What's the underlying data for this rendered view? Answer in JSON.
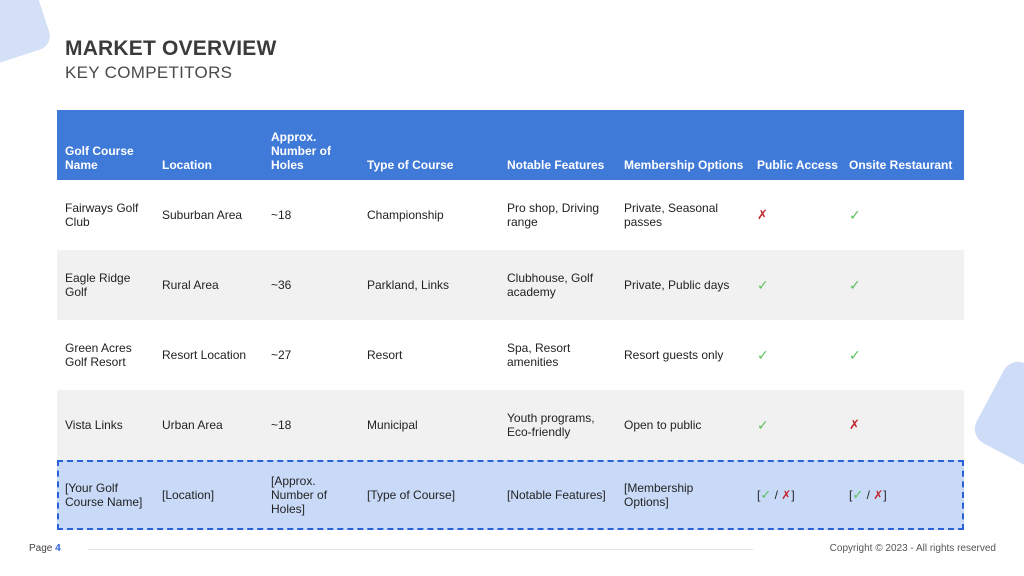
{
  "slide": {
    "title": "MARKET OVERVIEW",
    "subtitle": "KEY COMPETITORS"
  },
  "table": {
    "headers": [
      "Golf Course Name",
      "Location",
      "Approx. Number of Holes",
      "Type of Course",
      "Notable Features",
      "Membership Options",
      "Public Access",
      "Onsite Restaurant"
    ],
    "rows": [
      {
        "name": "Fairways Golf Club",
        "location": "Suburban Area",
        "holes": "~18",
        "type": "Championship",
        "features": "Pro shop, Driving range",
        "membership": "Private, Seasonal passes",
        "public_access": "✗",
        "restaurant": "✓"
      },
      {
        "name": "Eagle Ridge Golf",
        "location": "Rural Area",
        "holes": "~36",
        "type": "Parkland, Links",
        "features": "Clubhouse, Golf academy",
        "membership": "Private, Public days",
        "public_access": "✓",
        "restaurant": "✓"
      },
      {
        "name": "Green Acres Golf Resort",
        "location": "Resort Location",
        "holes": "~27",
        "type": "Resort",
        "features": "Spa, Resort amenities",
        "membership": "Resort guests only",
        "public_access": "✓",
        "restaurant": "✓"
      },
      {
        "name": "Vista Links",
        "location": "Urban Area",
        "holes": "~18",
        "type": "Municipal",
        "features": "Youth programs, Eco-friendly",
        "membership": "Open to public",
        "public_access": "✓",
        "restaurant": "✗"
      }
    ],
    "template_row": {
      "name": "[Your Golf Course Name]",
      "location": "[Location]",
      "holes": "[Approx. Number of Holes]",
      "type": "[Type of Course]",
      "features": "[Notable Features]",
      "membership": "[Membership Options]",
      "public_access": {
        "open": "[",
        "check": "✓",
        "sep": " / ",
        "cross": "✗",
        "close": "]"
      },
      "restaurant": {
        "open": "[",
        "check": "✓",
        "sep": " / ",
        "cross": "✗",
        "close": "]"
      }
    }
  },
  "footer": {
    "page_label": "Page",
    "page_number": "4",
    "copyright": "Copyright © 2023 - All rights reserved"
  },
  "colors": {
    "header_bg": "#3f7ad9",
    "template_bg": "#c9daf8",
    "template_border": "#2a62d6",
    "check": "#5cc15c",
    "cross": "#c0262d"
  }
}
